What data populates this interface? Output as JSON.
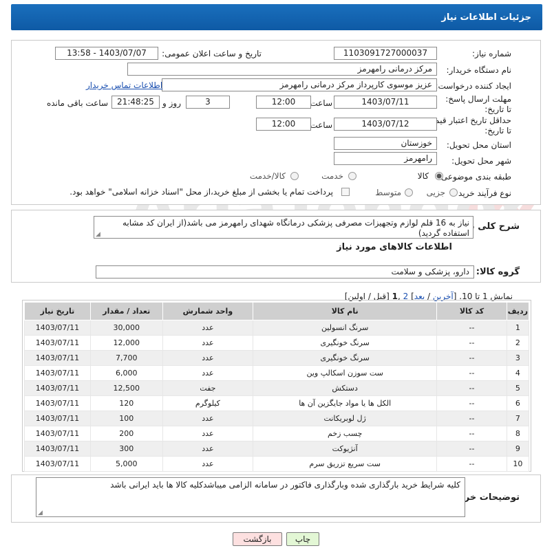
{
  "header": {
    "title": "جزئیات اطلاعات نیاز"
  },
  "form": {
    "need_number_label": "شماره نیاز:",
    "need_number": "1103091727000037",
    "announce_label": "تاریخ و ساعت اعلان عمومی:",
    "announce_value": "1403/07/07 - 13:58",
    "buyer_label": "نام دستگاه خریدار:",
    "buyer_value": "مرکز درمانی رامهرمز",
    "creator_label": "ایجاد کننده درخواست:",
    "creator_value": "عزیز موسوی کارپرداز مرکز درمانی رامهرمز",
    "contact_link": "اطلاعات تماس خریدار",
    "deadline_label": "مهلت ارسال پاسخ: تا تاریخ:",
    "deadline_date": "1403/07/11",
    "time_label": "ساعت",
    "deadline_time": "12:00",
    "days_value": "3",
    "days_label": "روز و",
    "remaining_time": "21:48:25",
    "remaining_label": "ساعت باقی مانده",
    "validity_label": "حداقل تاریخ اعتبار قیمت: تا تاریخ:",
    "validity_date": "1403/07/12",
    "validity_time": "12:00",
    "province_label": "استان محل تحویل:",
    "province_value": "خوزستان",
    "city_label": "شهر محل تحویل:",
    "city_value": "رامهرمز",
    "category_label": "طبقه بندی موضوعی:",
    "category_options": [
      "کالا",
      "خدمت",
      "کالا/خدمت"
    ],
    "process_label": "نوع فرآیند خرید :",
    "process_options": [
      "جزیی",
      "متوسط"
    ],
    "payment_note": "پرداخت تمام یا بخشی از مبلغ خرید،از محل \"اسناد خزانه اسلامی\" خواهد بود."
  },
  "description": {
    "label": "شرح کلی نیاز:",
    "text": "نیاز به 16 قلم لوازم وتجهیزات مصرفی پزشکی درمانگاه شهدای رامهرمز می باشد(از ایران کد مشابه استفاده گردید)"
  },
  "goods_info": {
    "title": "اطلاعات کالاهای مورد نیاز",
    "group_label": "گروه کالا:",
    "group_value": "دارو، پزشکی و سلامت"
  },
  "pagination": {
    "prefix": "نمایش 1 تا 10. [",
    "last": "آخرین",
    "sep1": " / ",
    "next": "بعد",
    "sep2": "] ",
    "page2": "2",
    "comma": " ,",
    "page1": "1",
    "suffix": " [قبل / اولین]"
  },
  "table": {
    "headers": [
      "ردیف",
      "کد کالا",
      "نام کالا",
      "واحد شمارش",
      "تعداد / مقدار",
      "تاریخ نیاز"
    ],
    "rows": [
      [
        "1",
        "--",
        "سرنگ انسولین",
        "عدد",
        "30,000",
        "1403/07/11"
      ],
      [
        "2",
        "--",
        "سرنگ خونگیری",
        "عدد",
        "12,000",
        "1403/07/11"
      ],
      [
        "3",
        "--",
        "سرنگ خونگیری",
        "عدد",
        "7,700",
        "1403/07/11"
      ],
      [
        "4",
        "--",
        "ست سوزن اسکالپ وین",
        "عدد",
        "6,000",
        "1403/07/11"
      ],
      [
        "5",
        "--",
        "دستکش",
        "جفت",
        "12,500",
        "1403/07/11"
      ],
      [
        "6",
        "--",
        "الکل ها یا مواد جایگزین آن ها",
        "کیلوگرم",
        "120",
        "1403/07/11"
      ],
      [
        "7",
        "--",
        "ژل لوبریکانت",
        "عدد",
        "100",
        "1403/07/11"
      ],
      [
        "8",
        "--",
        "چسب زخم",
        "عدد",
        "200",
        "1403/07/11"
      ],
      [
        "9",
        "--",
        "آنژیوکت",
        "عدد",
        "300",
        "1403/07/11"
      ],
      [
        "10",
        "--",
        "ست سریع تزریق سرم",
        "عدد",
        "5,000",
        "1403/07/11"
      ]
    ]
  },
  "buyer_notes": {
    "label": "توضیحات خریدار:",
    "text": "کلیه شرایط خرید بارگذاری شده وبارگذاری فاکتور در سامانه الزامی میباشدکلیه کالا ها باید ایرانی باشد"
  },
  "buttons": {
    "print": "چاپ",
    "back": "بازگشت"
  },
  "colors": {
    "header_bg": "#1a6fbd",
    "print_btn": "#e3f7d5",
    "back_btn": "#fde0e0"
  }
}
